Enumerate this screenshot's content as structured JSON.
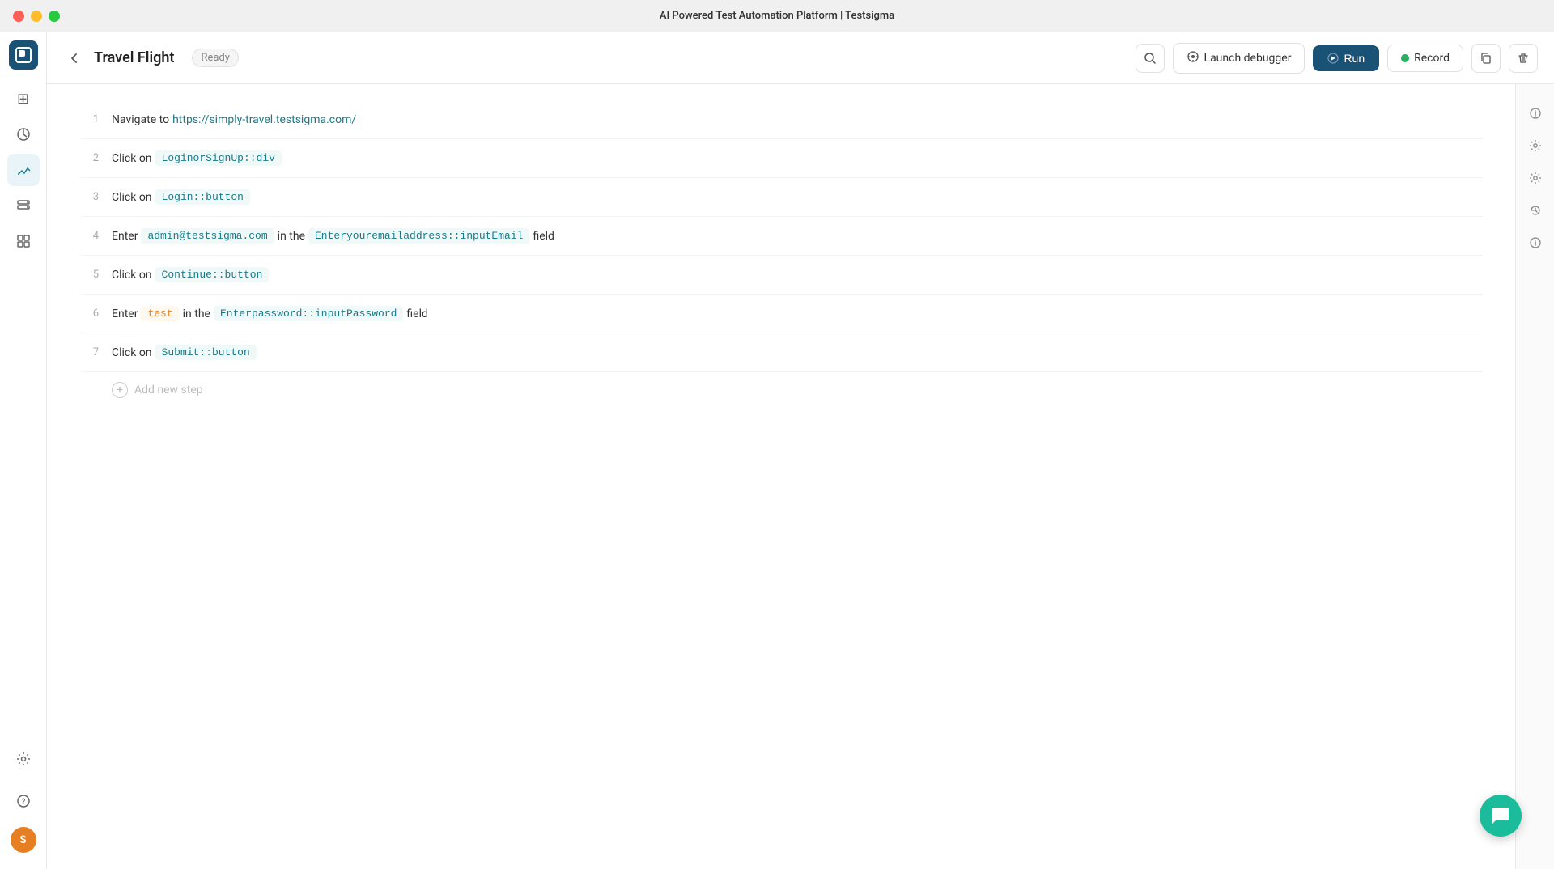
{
  "window": {
    "title": "AI Powered Test Automation Platform | Testsigma"
  },
  "header": {
    "back_label": "←",
    "title": "Travel Flight",
    "status": "Ready",
    "search_title": "Search",
    "launch_debugger_label": "Launch debugger",
    "run_label": "Run",
    "record_label": "Record",
    "copy_label": "Copy",
    "delete_label": "Delete"
  },
  "sidebar": {
    "logo_label": "Testsigma",
    "items": [
      {
        "id": "apps",
        "icon": "⊞",
        "label": "Apps",
        "active": false
      },
      {
        "id": "analytics",
        "icon": "◎",
        "label": "Analytics",
        "active": false
      },
      {
        "id": "editor",
        "icon": "✎",
        "label": "Editor",
        "active": true
      },
      {
        "id": "storage",
        "icon": "▤",
        "label": "Storage",
        "active": false
      },
      {
        "id": "components",
        "icon": "⊟",
        "label": "Components",
        "active": false
      },
      {
        "id": "settings-nav",
        "icon": "⚙",
        "label": "Settings",
        "active": false
      }
    ],
    "help_label": "Help",
    "avatar_label": "S"
  },
  "steps": [
    {
      "number": 1,
      "parts": [
        {
          "type": "keyword",
          "text": "Navigate to"
        },
        {
          "type": "link",
          "text": "https://simply-travel.testsigma.com/"
        }
      ]
    },
    {
      "number": 2,
      "parts": [
        {
          "type": "keyword",
          "text": "Click on"
        },
        {
          "type": "code",
          "text": "LoginorSignUp::div"
        }
      ]
    },
    {
      "number": 3,
      "parts": [
        {
          "type": "keyword",
          "text": "Click on"
        },
        {
          "type": "code",
          "text": "Login::button"
        }
      ]
    },
    {
      "number": 4,
      "parts": [
        {
          "type": "keyword",
          "text": "Enter"
        },
        {
          "type": "code",
          "text": "admin@testsigma.com"
        },
        {
          "type": "keyword",
          "text": "in the"
        },
        {
          "type": "code",
          "text": "Enteryouremailaddress::inputEmail"
        },
        {
          "type": "keyword",
          "text": "field"
        }
      ]
    },
    {
      "number": 5,
      "parts": [
        {
          "type": "keyword",
          "text": "Click on"
        },
        {
          "type": "code",
          "text": "Continue::button"
        }
      ]
    },
    {
      "number": 6,
      "parts": [
        {
          "type": "keyword",
          "text": "Enter"
        },
        {
          "type": "code-red",
          "text": "test"
        },
        {
          "type": "keyword",
          "text": "in the"
        },
        {
          "type": "code",
          "text": "Enterpassword::inputPassword"
        },
        {
          "type": "keyword",
          "text": "field"
        }
      ]
    },
    {
      "number": 7,
      "parts": [
        {
          "type": "keyword",
          "text": "Click on"
        },
        {
          "type": "code",
          "text": "Submit::button"
        }
      ]
    }
  ],
  "add_step": {
    "label": "Add new step"
  },
  "right_panel": {
    "icons": [
      {
        "id": "info",
        "icon": "ⓘ"
      },
      {
        "id": "settings-step",
        "icon": "⚙"
      },
      {
        "id": "settings2",
        "icon": "⚙"
      },
      {
        "id": "history",
        "icon": "↺"
      },
      {
        "id": "details",
        "icon": "ⓘ"
      }
    ]
  },
  "chat": {
    "label": "💬"
  }
}
